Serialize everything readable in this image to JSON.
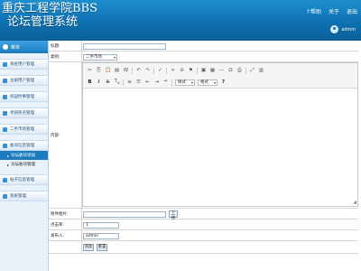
{
  "header": {
    "title_line1": "重庆工程学院BBS",
    "title_line2": "论坛管理系统",
    "nav_help": "帮助",
    "nav_about": "关于",
    "nav_exit": "退出",
    "username": "admin"
  },
  "sidebar": {
    "heading": "菜单",
    "groups": [
      {
        "label": "系统用户管理"
      },
      {
        "label": "注册用户管理"
      },
      {
        "label": "校园时事管理"
      },
      {
        "label": "考研热点管理"
      },
      {
        "label": "二手市场管理"
      },
      {
        "label": "板块信息管理"
      }
    ],
    "subitems": [
      {
        "label": "论坛板块添加",
        "active": true
      },
      {
        "label": "论坛板块管理",
        "active": false
      }
    ],
    "groups_after": [
      {
        "label": "帖子信息管理"
      },
      {
        "label": "系统管理"
      }
    ]
  },
  "form": {
    "title_label": "标题:",
    "title_value": "",
    "category_label": "类别:",
    "category_value": "二手市场",
    "content_label": "内容:",
    "attachment_label": "附件图片:",
    "upload_button": "上传",
    "views_label": "点击率:",
    "views_value": "1",
    "publisher_label": "发布人:",
    "publisher_value": "admin",
    "submit_button": "添加",
    "reset_button": "重置"
  },
  "editor": {
    "style_select": "样式",
    "format_select": "格式"
  }
}
